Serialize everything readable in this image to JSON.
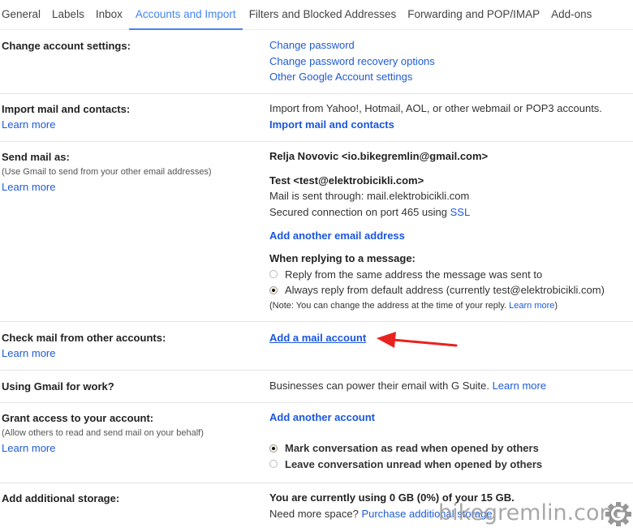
{
  "tabs": [
    {
      "label": "General",
      "active": false
    },
    {
      "label": "Labels",
      "active": false
    },
    {
      "label": "Inbox",
      "active": false
    },
    {
      "label": "Accounts and Import",
      "active": true
    },
    {
      "label": "Filters and Blocked Addresses",
      "active": false
    },
    {
      "label": "Forwarding and POP/IMAP",
      "active": false
    },
    {
      "label": "Add-ons",
      "active": false
    }
  ],
  "sections": {
    "change_account": {
      "label": "Change account settings:",
      "links": [
        "Change password",
        "Change password recovery options",
        "Other Google Account settings"
      ]
    },
    "import": {
      "label": "Import mail and contacts:",
      "learn_more": "Learn more",
      "description": "Import from Yahoo!, Hotmail, AOL, or other webmail or POP3 accounts.",
      "action": "Import mail and contacts"
    },
    "send_as": {
      "label": "Send mail as:",
      "sublabel": "(Use Gmail to send from your other email addresses)",
      "learn_more": "Learn more",
      "primary_address": "Relja Novovic <io.bikegremlin@gmail.com>",
      "secondary_address": "Test <test@elektrobicikli.com>",
      "sent_through": "Mail is sent through: mail.elektrobicikli.com",
      "secured_prefix": "Secured connection on port 465 using ",
      "secured_link": "SSL",
      "add_address": "Add another email address",
      "reply_heading": "When replying to a message:",
      "reply_options": [
        {
          "label": "Reply from the same address the message was sent to",
          "selected": false
        },
        {
          "label": "Always reply from default address (currently test@elektrobicikli.com)",
          "selected": true
        }
      ],
      "note_prefix": "(Note: You can change the address at the time of your reply. ",
      "note_link": "Learn more",
      "note_suffix": ")"
    },
    "check_mail": {
      "label": "Check mail from other accounts:",
      "learn_more": "Learn more",
      "action": "Add a mail account"
    },
    "work": {
      "label": "Using Gmail for work?",
      "description": "Businesses can power their email with G Suite. ",
      "learn_more": "Learn more"
    },
    "grant": {
      "label": "Grant access to your account:",
      "sublabel": "(Allow others to read and send mail on your behalf)",
      "learn_more": "Learn more",
      "action": "Add another account",
      "options": [
        {
          "label": "Mark conversation as read when opened by others",
          "selected": true
        },
        {
          "label": "Leave conversation unread when opened by others",
          "selected": false
        }
      ]
    },
    "storage": {
      "label": "Add additional storage:",
      "usage": "You are currently using 0 GB (0%) of your 15 GB.",
      "need_more": "Need more space? ",
      "purchase": "Purchase additional storage"
    }
  },
  "watermark": "bikegremlin.com",
  "colors": {
    "accent": "#4285f4",
    "link": "#1f5bd6",
    "annotation_arrow": "#e8221f"
  }
}
